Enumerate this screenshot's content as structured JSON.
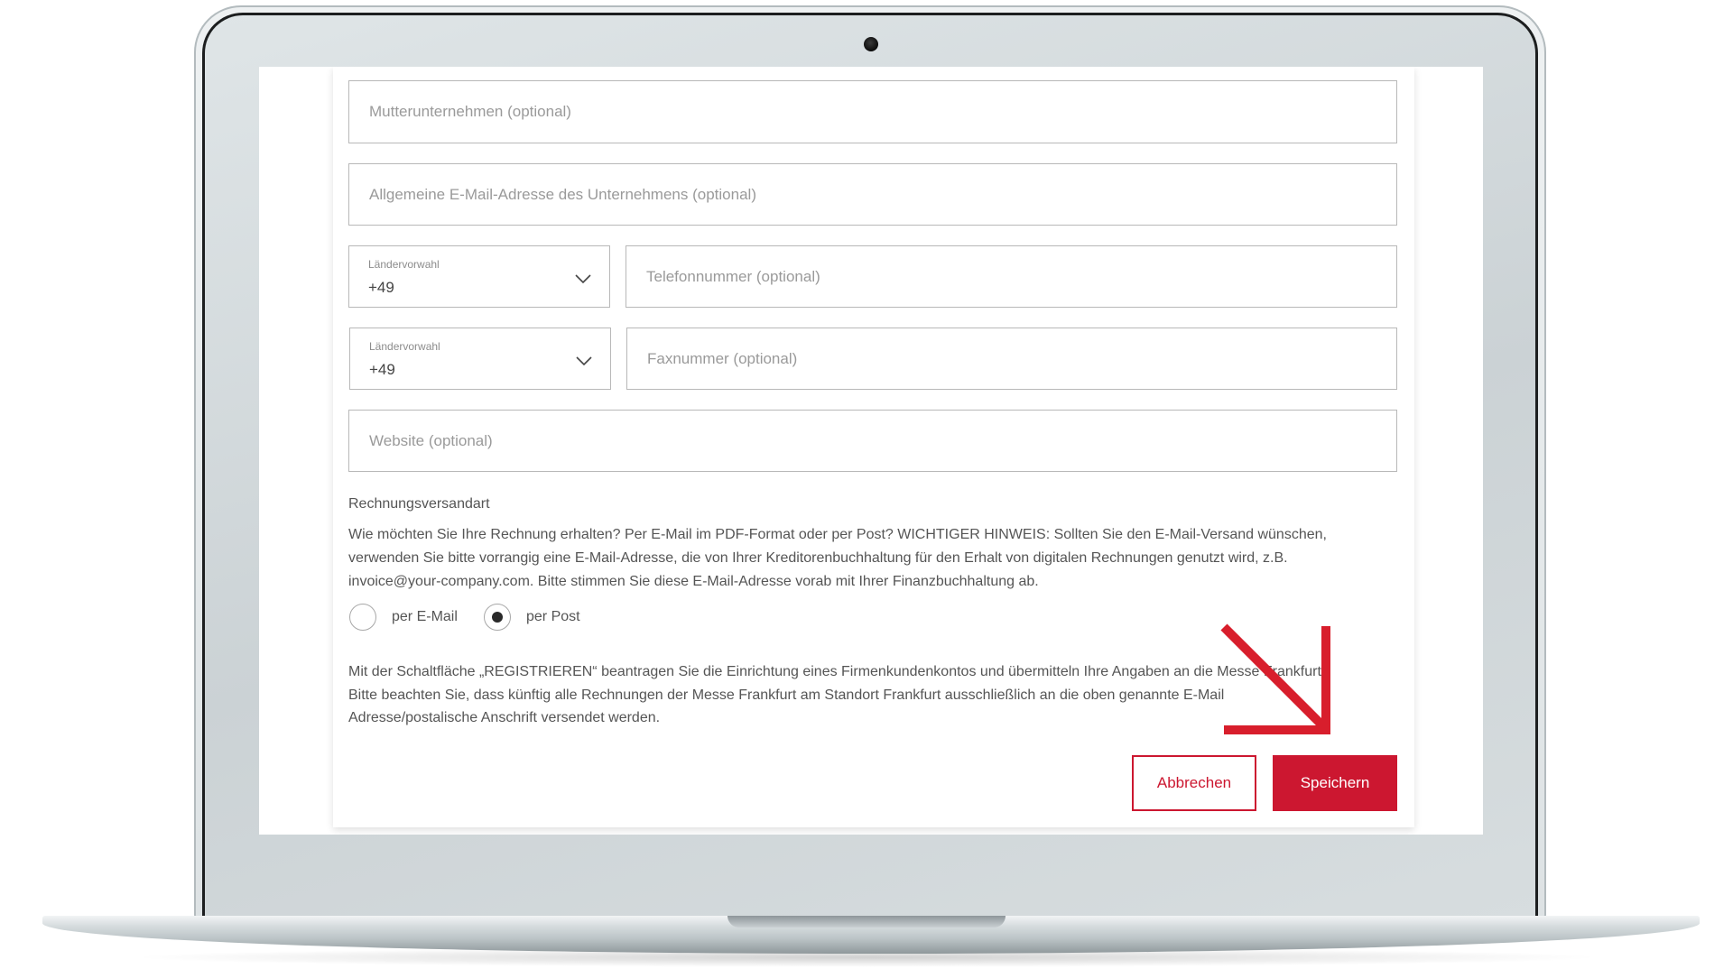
{
  "form": {
    "fields": {
      "parent_company": {
        "placeholder": "Mutterunternehmen (optional)"
      },
      "general_email": {
        "placeholder": "Allgemeine E-Mail-Adresse des Unternehmens (optional)"
      },
      "phone_country": {
        "label": "Ländervorwahl",
        "value": "+49"
      },
      "phone": {
        "placeholder": "Telefonnummer (optional)"
      },
      "fax_country": {
        "label": "Ländervorwahl",
        "value": "+49"
      },
      "fax": {
        "placeholder": "Faxnummer (optional)"
      },
      "website": {
        "placeholder": "Website (optional)"
      }
    },
    "invoice_delivery": {
      "title": "Rechnungsversandart",
      "description_lines": [
        "Wie möchten Sie Ihre Rechnung erhalten? Per E-Mail im PDF-Format oder per Post? WICHTIGER HINWEIS: Sollten Sie den E-Mail-Versand wünschen,",
        "verwenden Sie bitte vorrangig eine E-Mail-Adresse, die von Ihrer Kreditorenbuchhaltung für den Erhalt von digitalen Rechnungen genutzt wird, z.B.",
        "invoice@your-company.com. Bitte stimmen Sie diese E-Mail-Adresse vorab mit Ihrer Finanzbuchhaltung ab."
      ],
      "options": [
        {
          "label": "per E-Mail",
          "selected": false
        },
        {
          "label": "per Post",
          "selected": true
        }
      ]
    },
    "notice_lines": [
      "Mit der Schaltfläche „REGISTRIEREN“ beantragen Sie die Einrichtung eines Firmenkundenkontos und übermitteln Ihre Angaben an die Messe Frankfurt.",
      "Bitte beachten Sie, dass künftig alle Rechnungen der Messe Frankfurt am Standort Frankfurt ausschließlich an die oben genannte E-Mail",
      "Adresse/postalische Anschrift versendet werden."
    ],
    "buttons": {
      "cancel": "Abbrechen",
      "save": "Speichern"
    }
  },
  "icons": {
    "select_arrow": "chevron-down-icon",
    "annotation": "arrow-down-right-icon"
  },
  "colors": {
    "accent": "#cc1730",
    "annotation_arrow": "#d81e2c",
    "laptop_silver": "#d6dcde"
  }
}
